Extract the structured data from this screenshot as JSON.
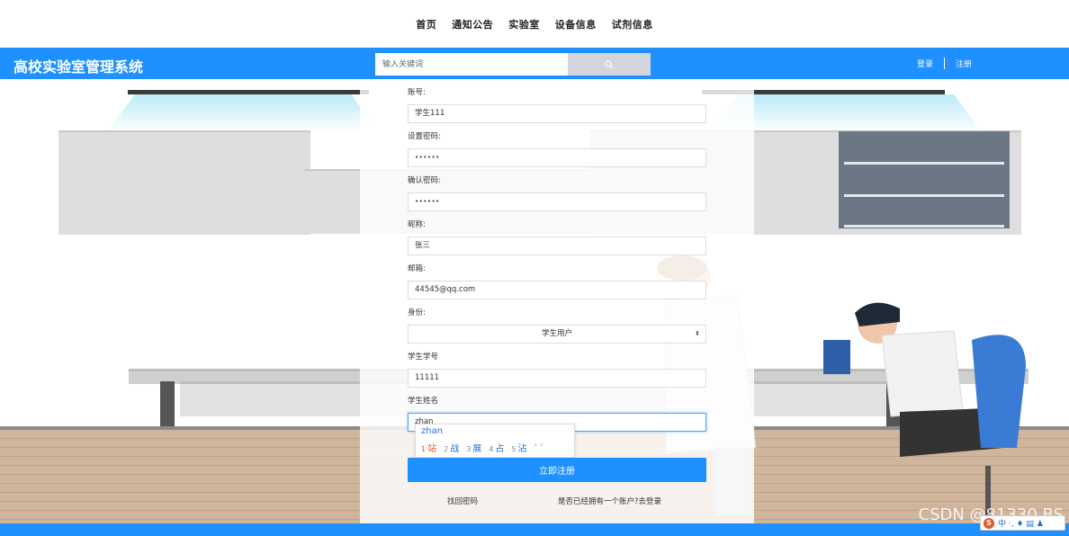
{
  "nav": {
    "items": [
      "首页",
      "通知公告",
      "实验室",
      "设备信息",
      "试剂信息"
    ]
  },
  "header": {
    "brand": "高校实验室管理系统",
    "search_placeholder": "输入关键词",
    "search_icon": "search-icon",
    "login": "登录",
    "register": "注册"
  },
  "form": {
    "account_label": "账号:",
    "account_value": "学生111",
    "password_label": "设置密码:",
    "password_value": "••••••",
    "confirm_label": "确认密码:",
    "confirm_value": "••••••",
    "nickname_label": "昵称:",
    "nickname_value": "张三",
    "email_label": "邮箱:",
    "email_value": "44545@qq.com",
    "role_label": "身份:",
    "role_value": "学生用户",
    "student_id_label": "学生学号",
    "student_id_value": "11111",
    "student_name_label": "学生姓名",
    "student_name_value": "zhan",
    "submit": "立即注册",
    "forgot": "找回密码",
    "has_account": "是否已经拥有一个账户?去登录"
  },
  "ime": {
    "pinyin": "zhan",
    "candidates": [
      {
        "n": "1",
        "c": "站"
      },
      {
        "n": "2",
        "c": "战"
      },
      {
        "n": "3",
        "c": "展"
      },
      {
        "n": "4",
        "c": "占"
      },
      {
        "n": "5",
        "c": "沾"
      }
    ],
    "nav": "‹ ›"
  },
  "watermark": "CSDN @81330 BS",
  "imebar": {
    "logo": "S",
    "text": "中 ·, ♦ ▤ ♟"
  },
  "colors": {
    "primary": "#1e90ff",
    "ime_highlight": "#e8562a"
  }
}
